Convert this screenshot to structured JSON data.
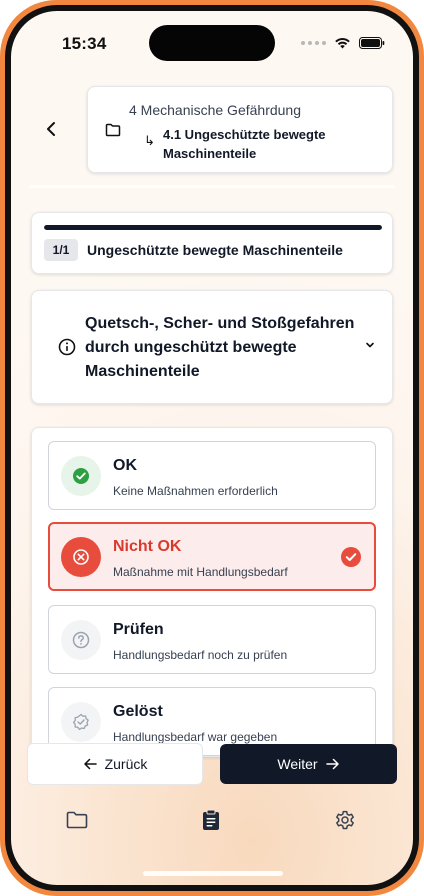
{
  "status": {
    "time": "15:34"
  },
  "breadcrumb": {
    "parent": "4 Mechanische Gefährdung",
    "child": "4.1 Ungeschützte bewegte Maschinenteile",
    "child_arrow": "↳"
  },
  "progress": {
    "badge": "1/1",
    "title": "Ungeschützte bewegte Maschinenteile",
    "value": 1.0
  },
  "question": {
    "text": "Quetsch-, Scher- und Stoßgefahren durch ungeschützt bewegte Maschinenteile"
  },
  "options": [
    {
      "title": "OK",
      "subtitle": "Keine Maßnahmen erforderlich",
      "icon": "check-circle-icon",
      "selected": false
    },
    {
      "title": "Nicht OK",
      "subtitle": "Maßnahme mit Handlungsbedarf",
      "icon": "x-circle-icon",
      "selected": true
    },
    {
      "title": "Prüfen",
      "subtitle": "Handlungsbedarf noch zu prüfen",
      "icon": "question-circle-icon",
      "selected": false
    },
    {
      "title": "Gelöst",
      "subtitle": "Handlungsbedarf war gegeben",
      "icon": "badge-check-icon",
      "selected": false
    }
  ],
  "buttons": {
    "back": "Zurück",
    "next": "Weiter"
  },
  "colors": {
    "accent": "#111827",
    "danger": "#e74c3c",
    "success": "#2ea043",
    "frame": "#f2883f"
  },
  "tabs": [
    {
      "name": "folder-icon",
      "active": false
    },
    {
      "name": "clipboard-icon",
      "active": true
    },
    {
      "name": "settings-icon",
      "active": false
    }
  ]
}
